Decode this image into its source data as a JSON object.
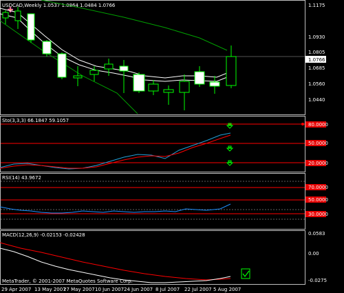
{
  "colors": {
    "background": "#000000",
    "frame": "#c0c0c0",
    "bull_candle": "#ffffff",
    "bear_candle": "#000000",
    "wick_green": "#00ff00",
    "ma_fast": "#ffffff",
    "ma_slow": "#00a000",
    "stoch_main": "#22a0d8",
    "stoch_signal": "#ff0000",
    "level_red": "#ff0000",
    "rsi_line": "#1e90ff",
    "macd_main": "#ffffff",
    "macd_signal": "#ff0000",
    "price_tag_bg": "#ffffff"
  },
  "main": {
    "header": "USDCAD,Weekly  1.0537 1.0864 1.0484 1.0766",
    "price_labels": [
      "1.1175",
      "1.0930",
      "1.0805",
      "1.0685",
      "1.0560",
      "1.0440"
    ],
    "current_price": "1.0766",
    "icon": "flower-icon"
  },
  "stoch": {
    "header": "Sto(3,3,3) 66.1847 59.1057",
    "levels": [
      "80.0000",
      "50.0000",
      "20.0000"
    ],
    "arrows": [
      "down-arrow-icon",
      "down-arrow-icon",
      "down-arrow-icon"
    ]
  },
  "rsi": {
    "header": "RSI(14) 43.9672",
    "levels": [
      "70.0000",
      "50.0000",
      "30.0000"
    ]
  },
  "macd": {
    "header": "MACD(12,26,9) -0.02153 -0.02428",
    "labels": [
      "0.0583",
      "0.00",
      "-0.0275"
    ],
    "copyright": "MetaTrader, © 2001-2007 MetaQuotes Software Corp."
  },
  "x_axis": {
    "labels": [
      "29 Apr 2007",
      "13 May 2007",
      "27 May 2007",
      "10 Jun 2007",
      "24 Jun 2007",
      "8 Jul 2007",
      "22 Jul 2007",
      "5 Aug 2007"
    ]
  }
}
